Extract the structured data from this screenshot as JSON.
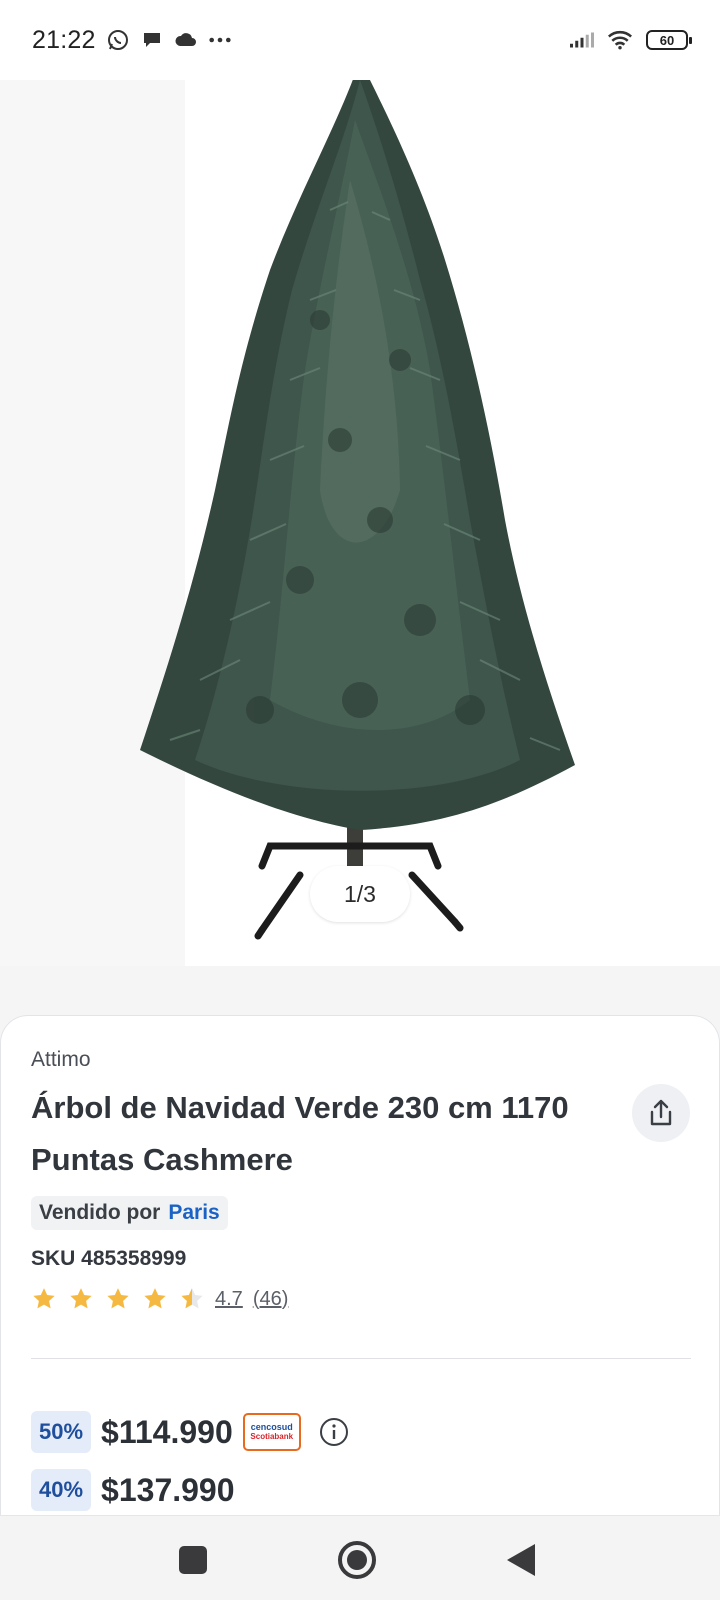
{
  "status_bar": {
    "time": "21:22",
    "left_icons": [
      "whatsapp-icon",
      "chat-bubble-icon",
      "cloud-icon",
      "more-dots-icon"
    ],
    "right_icons": [
      "signal-icon",
      "wifi-icon",
      "battery-icon"
    ],
    "battery_level": "60"
  },
  "gallery": {
    "counter": "1/3",
    "image": "christmas-tree-product-image"
  },
  "product": {
    "brand": "Attimo",
    "title": "Árbol de Navidad Verde 230 cm 1170 Puntas Cashmere",
    "seller_label": "Vendido por",
    "seller_name": "Paris",
    "sku": "SKU 485358999",
    "rating_value": "4.7",
    "rating_count": "(46)",
    "rating_stars": 4.7
  },
  "prices": [
    {
      "discount": "50%",
      "price": "$114.990",
      "bank_logo": {
        "line1": "cencosud",
        "line2": "Scotiabank"
      }
    },
    {
      "discount": "40%",
      "price": "$137.990"
    }
  ],
  "colors": {
    "accent_blue": "#1a63c4",
    "discount_bg": "#e4ecfa",
    "star": "#f5b942",
    "bank_orange": "#e86a1f"
  },
  "nav": [
    "recents-button",
    "home-button",
    "back-button"
  ]
}
